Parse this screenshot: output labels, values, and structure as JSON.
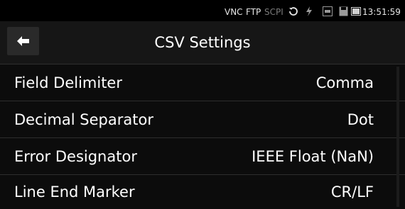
{
  "status_bar": {
    "vnc": "VNC",
    "ftp": "FTP",
    "scpi": "SCPI",
    "time": "13:51:59"
  },
  "header": {
    "title": "CSV Settings"
  },
  "rows": [
    {
      "label": "Field Delimiter",
      "value": "Comma"
    },
    {
      "label": "Decimal Separator",
      "value": "Dot"
    },
    {
      "label": "Error Designator",
      "value": "IEEE Float (NaN)"
    },
    {
      "label": "Line End Marker",
      "value": "CR/LF"
    }
  ],
  "colors": {
    "background": "#000000",
    "header": "#161616",
    "row": "#0c0c0c",
    "text": "#ffffff",
    "inactive": "#7a7a7a"
  },
  "icons": {
    "back": "arrow-left-icon",
    "sync": "sync-icon",
    "power": "lightning-icon",
    "log": "log-icon",
    "save": "floppy-disk-icon",
    "screenshot": "screen-icon"
  }
}
